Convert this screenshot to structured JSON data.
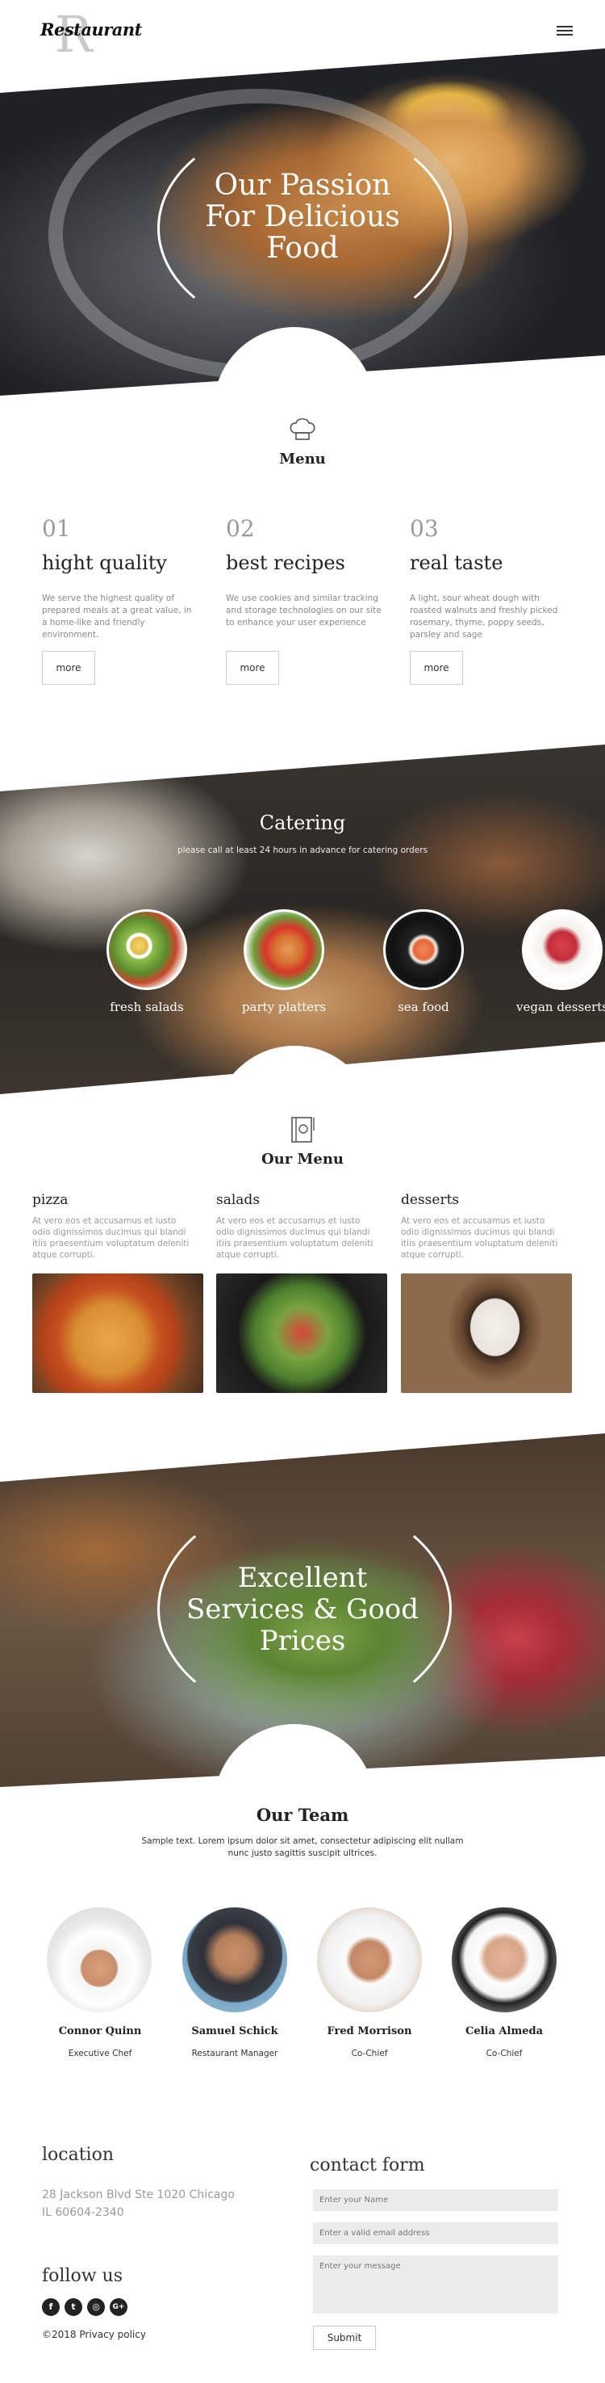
{
  "header": {
    "logo_letter": "R",
    "logo_text": "Restaurant"
  },
  "hero": {
    "title_l1": "Our Passion",
    "title_l2": "For Delicious",
    "title_l3": "Food"
  },
  "menu": {
    "title": "Menu",
    "columns": [
      {
        "num": "01",
        "heading": "hight quality",
        "text": "We serve the highest quality of prepared meals at a great value,  in a home-like and friendly environment.",
        "button": "more"
      },
      {
        "num": "02",
        "heading": "best recipes",
        "text": "We use cookies and similar tracking and storage technologies on our site to enhance your user experience",
        "button": "more"
      },
      {
        "num": "03",
        "heading": "real taste",
        "text": "A light, sour wheat dough with roasted walnuts and freshly picked rosemary, thyme, poppy seeds, parsley and sage",
        "button": "more"
      }
    ]
  },
  "catering": {
    "title": "Catering",
    "subtitle": "please call at least 24 hours in advance for catering orders",
    "items": [
      "fresh salads",
      "party platters",
      "sea food",
      "vegan desserts"
    ]
  },
  "our_menu": {
    "title": "Our Menu",
    "items": [
      {
        "heading": "pizza",
        "text": "At vero eos et accusamus et iusto odio dignissimos ducimus qui blandi itiis praesentium voluptatum deleniti atque corrupti."
      },
      {
        "heading": "salads",
        "text": "At vero eos et accusamus et iusto odio dignissimos ducimus qui blandi itiis praesentium voluptatum deleniti atque corrupti."
      },
      {
        "heading": "desserts",
        "text": "At vero eos et accusamus et iusto odio dignissimos ducimus qui blandi itiis praesentium voluptatum deleniti atque corrupti."
      }
    ]
  },
  "services": {
    "title_l1": "Excellent",
    "title_l2": "Services & Good",
    "title_l3": "Prices"
  },
  "team": {
    "title": "Our Team",
    "text": "Sample text. Lorem ipsum dolor sit amet, consectetur adipiscing elit nullam nunc justo sagittis suscipit ultrices.",
    "members": [
      {
        "name": "Connor Quinn",
        "role": "Executive Chef"
      },
      {
        "name": "Samuel Schick",
        "role": "Restaurant Manager"
      },
      {
        "name": "Fred Morrison",
        "role": "Co-Chief"
      },
      {
        "name": "Celia Almeda",
        "role": "Co-Chief"
      }
    ]
  },
  "footer": {
    "location_title": "location",
    "address_l1": "28 Jackson Blvd Ste 1020 Chicago",
    "address_l2": "IL 60604-2340",
    "follow_title": "follow us",
    "socials": [
      "facebook-icon",
      "twitter-icon",
      "instagram-icon",
      "google-plus-icon"
    ],
    "copyright": "©2018 Privacy policy",
    "contact_title": "contact form",
    "name_placeholder": "Enter your Name",
    "email_placeholder": "Enter a valid email address",
    "message_placeholder": "Enter your message",
    "submit_label": "Submit"
  }
}
